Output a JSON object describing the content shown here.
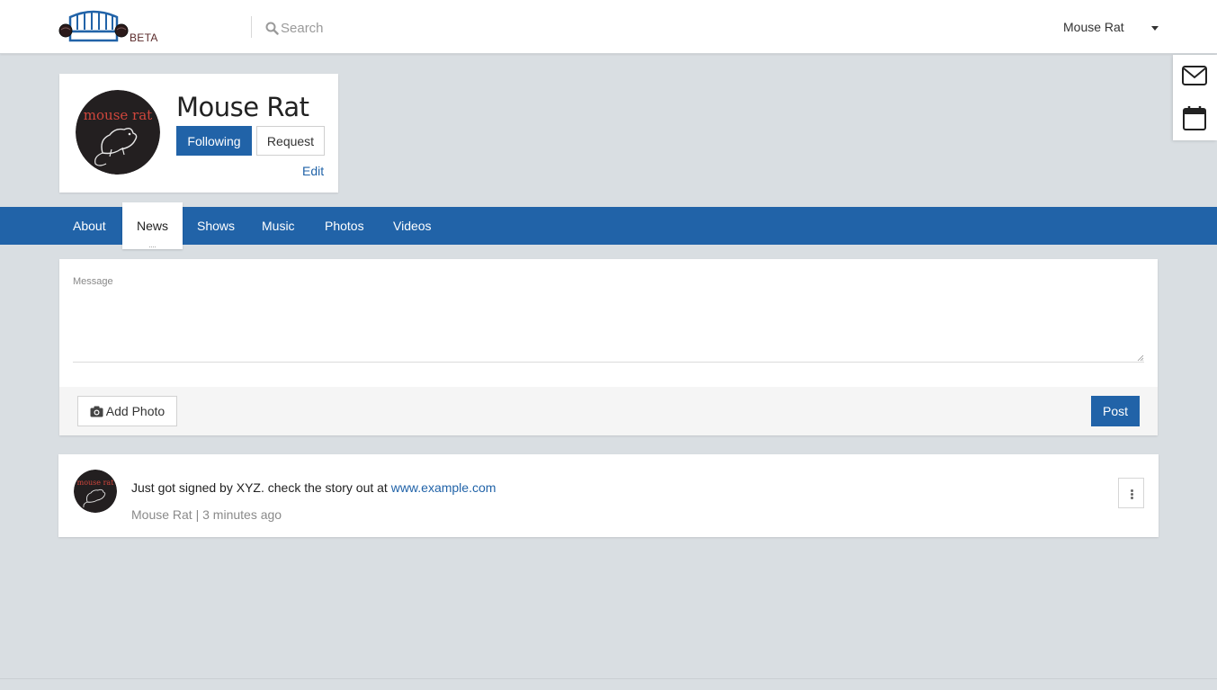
{
  "header": {
    "logo_icon": "sofa-logo-icon",
    "beta_label": "BETA",
    "search": {
      "icon": "search-icon",
      "placeholder": "Search",
      "value": ""
    },
    "user_name": "Mouse Rat",
    "menu_icon": "caret-down-icon"
  },
  "side_panel": {
    "items": [
      {
        "icon": "envelope-icon"
      },
      {
        "icon": "calendar-icon"
      }
    ]
  },
  "profile": {
    "name": "Mouse Rat",
    "avatar_text": "mouse rat",
    "following_label": "Following",
    "request_label": "Request",
    "edit_label": "Edit"
  },
  "tabs": [
    {
      "label": "About",
      "active": false
    },
    {
      "label": "News",
      "active": true
    },
    {
      "label": "Shows",
      "active": false
    },
    {
      "label": "Music",
      "active": false
    },
    {
      "label": "Photos",
      "active": false
    },
    {
      "label": "Videos",
      "active": false
    }
  ],
  "composer": {
    "message_label": "Message",
    "message_value": "",
    "add_photo_label": "Add Photo",
    "post_label": "Post"
  },
  "post": {
    "text": "Just got signed by XYZ. check the story out at ",
    "link": "www.example.com",
    "author": "Mouse Rat",
    "separator": " | ",
    "time": "3 minutes ago"
  },
  "colors": {
    "brand_blue": "#2163a8",
    "page_bg": "#d9dee2",
    "avatar_bg": "#231f20",
    "avatar_text": "#d0463c"
  }
}
